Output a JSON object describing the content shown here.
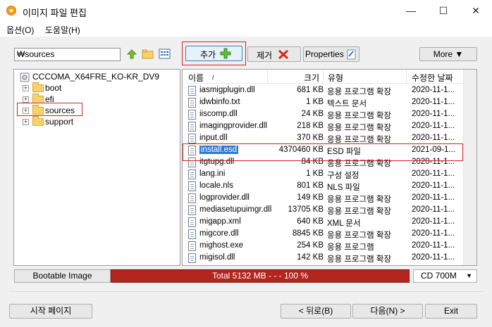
{
  "window": {
    "title": "이미지 파일 편집"
  },
  "menu": [
    "옵션(O)",
    "도움말(H)"
  ],
  "path": {
    "value": "₩sources"
  },
  "toolbar": {
    "add_label": "추가",
    "remove_label": "제거",
    "properties_label": "Properties",
    "more_label": "More ▼"
  },
  "tree": {
    "root": "CCCOMA_X64FRE_KO-KR_DV9",
    "items": [
      "boot",
      "efi",
      "sources",
      "support"
    ]
  },
  "list": {
    "columns": [
      "이름",
      "크기",
      "유형",
      "수정한 날짜"
    ],
    "rows": [
      {
        "name": "iasmigplugin.dll",
        "size": "681 KB",
        "type": "응용 프로그램 확장",
        "date": "2020-11-1..."
      },
      {
        "name": "idwbinfo.txt",
        "size": "1 KB",
        "type": "텍스트 문서",
        "date": "2020-11-1..."
      },
      {
        "name": "iiscomp.dll",
        "size": "24 KB",
        "type": "응용 프로그램 확장",
        "date": "2020-11-1..."
      },
      {
        "name": "imagingprovider.dll",
        "size": "218 KB",
        "type": "응용 프로그램 확장",
        "date": "2020-11-1..."
      },
      {
        "name": "input.dll",
        "size": "370 KB",
        "type": "응용 프로그램 확장",
        "date": "2020-11-1..."
      },
      {
        "name": "install.esd",
        "size": "4370460 KB",
        "type": "ESD 파일",
        "date": "2021-09-1..."
      },
      {
        "name": "itgtupg.dll",
        "size": "84 KB",
        "type": "응용 프로그램 확장",
        "date": "2020-11-1..."
      },
      {
        "name": "lang.ini",
        "size": "1 KB",
        "type": "구성 설정",
        "date": "2020-11-1..."
      },
      {
        "name": "locale.nls",
        "size": "801 KB",
        "type": "NLS 파일",
        "date": "2020-11-1..."
      },
      {
        "name": "logprovider.dll",
        "size": "149 KB",
        "type": "응용 프로그램 확장",
        "date": "2020-11-1..."
      },
      {
        "name": "mediasetupuimgr.dll",
        "size": "13705 KB",
        "type": "응용 프로그램 확장",
        "date": "2020-11-1..."
      },
      {
        "name": "migapp.xml",
        "size": "640 KB",
        "type": "XML 문서",
        "date": "2020-11-1..."
      },
      {
        "name": "migcore.dll",
        "size": "8845 KB",
        "type": "응용 프로그램 확장",
        "date": "2020-11-1..."
      },
      {
        "name": "mighost.exe",
        "size": "254 KB",
        "type": "응용 프로그램",
        "date": "2020-11-1..."
      },
      {
        "name": "migisol.dll",
        "size": "142 KB",
        "type": "응용 프로그램 확장",
        "date": "2020-11-1..."
      }
    ]
  },
  "status": {
    "label": "Bootable Image",
    "total": "Total  5132 MB   - - -  100 %",
    "progress_percent": 100,
    "media": "CD 700M"
  },
  "footer": {
    "start_page": "시작 페이지",
    "back": "< 뒤로(B)",
    "next": "다음(N) >",
    "exit": "Exit"
  },
  "colors": {
    "accent": "#2f7ad6",
    "progress": "#b3261e",
    "highlight": "#d32020"
  }
}
